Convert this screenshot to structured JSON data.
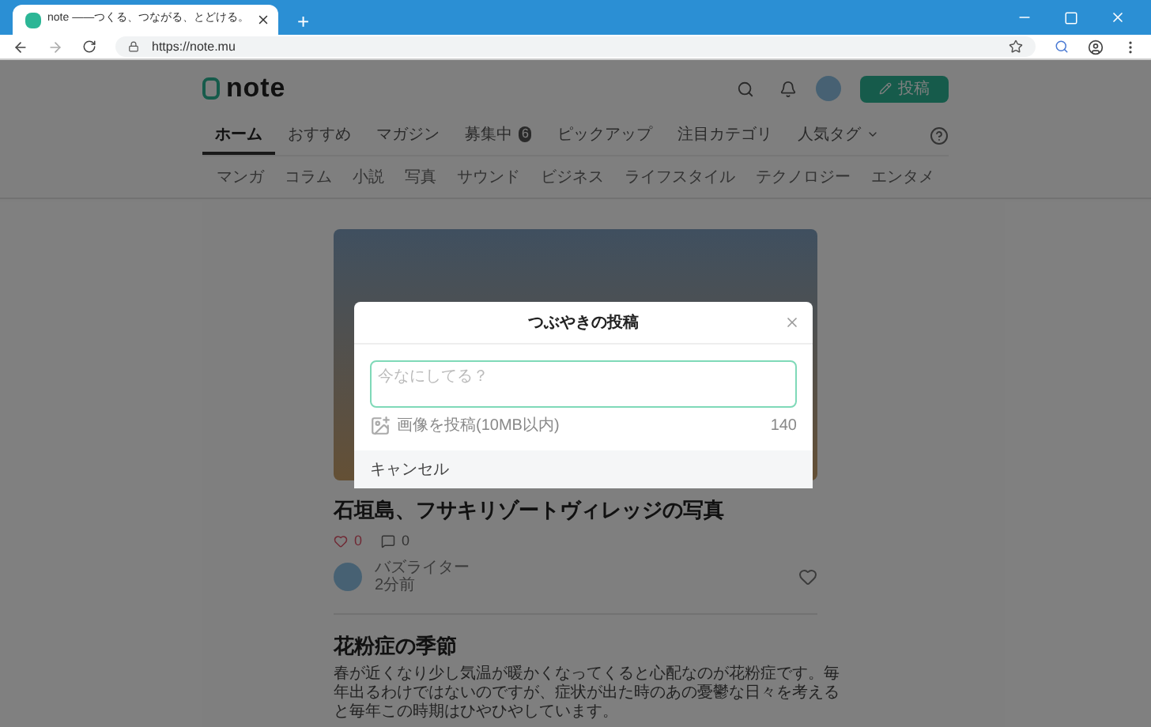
{
  "browser": {
    "tab_title": "note ——つくる、つながる、とどける。",
    "new_tab": "+",
    "url": "https://note.mu"
  },
  "header": {
    "logo": "note",
    "post_button": "投稿"
  },
  "nav_tabs": [
    {
      "label": "ホーム",
      "selected": true
    },
    {
      "label": "おすすめ",
      "selected": false
    },
    {
      "label": "マガジン",
      "selected": false
    },
    {
      "label": "募集中",
      "badge": "6",
      "selected": false
    },
    {
      "label": "ピックアップ",
      "selected": false
    },
    {
      "label": "注目カテゴリ",
      "selected": false
    },
    {
      "label": "人気タグ",
      "dropdown": true,
      "selected": false
    }
  ],
  "categories": [
    "マンガ",
    "コラム",
    "小説",
    "写真",
    "サウンド",
    "ビジネス",
    "ライフスタイル",
    "テクノロジー",
    "エンタメ"
  ],
  "articles": [
    {
      "title": "石垣島、フサキリゾートヴィレッジの写真",
      "likes": "0",
      "comments": "0",
      "author": "バズライター",
      "time": "2分前"
    },
    {
      "title": "花粉症の季節",
      "excerpt": "春が近くなり少し気温が暖かくなってくると心配なのが花粉症です。毎年出るわけではないのですが、症状が出た時のあの憂鬱な日々を考えると毎年この時期はひやひやしています。"
    }
  ],
  "dialog": {
    "title": "つぶやきの投稿",
    "placeholder": "今なにしてる？",
    "image_label": "画像を投稿(10MB以内)",
    "char_count": "140",
    "cancel": "キャンセル"
  }
}
